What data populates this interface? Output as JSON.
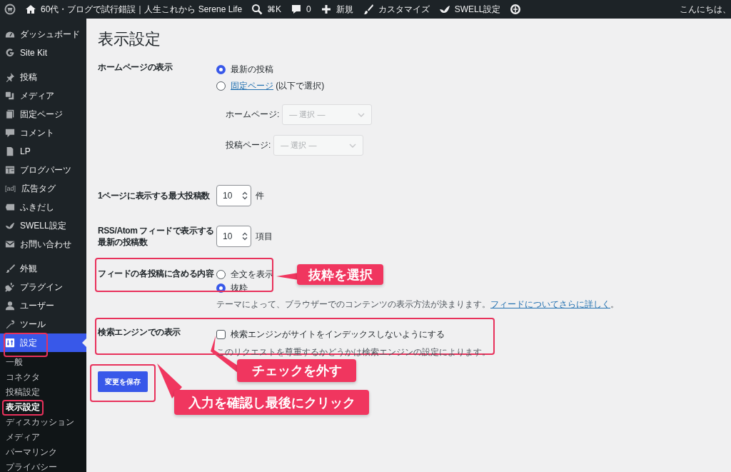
{
  "admin_bar": {
    "site_name": "60代・ブログで試行錯誤｜人生これから Serene Life",
    "search_shortcut": "⌘K",
    "comments_count": "0",
    "new_label": "新規",
    "customize_label": "カスタマイズ",
    "swell_label": "SWELL設定",
    "greeting": "こんにちは、"
  },
  "sidebar": {
    "groups": [
      {
        "items": [
          {
            "label": "ダッシュボード",
            "selected": false
          },
          {
            "label": "Site Kit",
            "selected": false
          }
        ]
      },
      {
        "items": [
          {
            "label": "投稿",
            "selected": false
          },
          {
            "label": "メディア",
            "selected": false
          },
          {
            "label": "固定ページ",
            "selected": false
          },
          {
            "label": "コメント",
            "selected": false
          },
          {
            "label": "LP",
            "selected": false
          },
          {
            "label": "ブログパーツ",
            "selected": false
          },
          {
            "label": "広告タグ",
            "selected": false,
            "icon_text": "[ad]"
          },
          {
            "label": "ふきだし",
            "selected": false
          },
          {
            "label": "SWELL設定",
            "selected": false
          },
          {
            "label": "お問い合わせ",
            "selected": false
          }
        ]
      },
      {
        "items": [
          {
            "label": "外観",
            "selected": false
          },
          {
            "label": "プラグイン",
            "selected": false
          },
          {
            "label": "ユーザー",
            "selected": false
          },
          {
            "label": "ツール",
            "selected": false
          },
          {
            "label": "設定",
            "selected": true,
            "highlighted": true,
            "submenu": [
              {
                "label": "一般",
                "selected": false
              },
              {
                "label": "コネクタ",
                "selected": false
              },
              {
                "label": "投稿設定",
                "selected": false
              },
              {
                "label": "表示設定",
                "selected": true,
                "highlighted": true
              },
              {
                "label": "ディスカッション",
                "selected": false
              },
              {
                "label": "メディア",
                "selected": false
              },
              {
                "label": "パーマリンク",
                "selected": false
              },
              {
                "label": "プライバシー",
                "selected": false
              }
            ]
          }
        ]
      }
    ]
  },
  "page_title": "表示設定",
  "homepage_display": {
    "label": "ホームページの表示",
    "options": [
      {
        "text": "最新の投稿",
        "selected": true
      },
      {
        "link": "固定ページ",
        "after": " (以下で選択)",
        "selected": false
      }
    ],
    "selects": [
      {
        "label": "ホームページ:",
        "value": "— 選択 —",
        "disabled": true
      },
      {
        "label": "投稿ページ:",
        "value": "— 選択 —",
        "disabled": true
      }
    ]
  },
  "posts_per_page": {
    "label": "1ページに表示する最大投稿数",
    "value": "10",
    "unit": "件"
  },
  "feed_count": {
    "label": "RSS/Atom フィードで表示する最新の投稿数",
    "value": "10",
    "unit": "項目"
  },
  "feed_content": {
    "label": "フィードの各投稿に含める内容",
    "highlighted": true,
    "options": [
      {
        "text": "全文を表示",
        "selected": false
      },
      {
        "text": "抜粋",
        "selected": true
      }
    ],
    "description": {
      "before": "テーマによって、ブラウザーでのコンテンツの表示方法が決まります。",
      "link": "フィードについてさらに詳しく",
      "after": "。"
    },
    "callout": "抜粋を選択"
  },
  "search_visibility": {
    "label": "検索エンジンでの表示",
    "highlighted": true,
    "checkbox": {
      "text": "検索エンジンがサイトをインデックスしないようにする",
      "checked": false
    },
    "description": "このリクエストを尊重するかどうかは検索エンジンの設定によります。",
    "callout": "チェックを外す"
  },
  "save_button": {
    "label": "変更を保存",
    "highlighted": true,
    "callout": "入力を確認し最後にクリック"
  }
}
